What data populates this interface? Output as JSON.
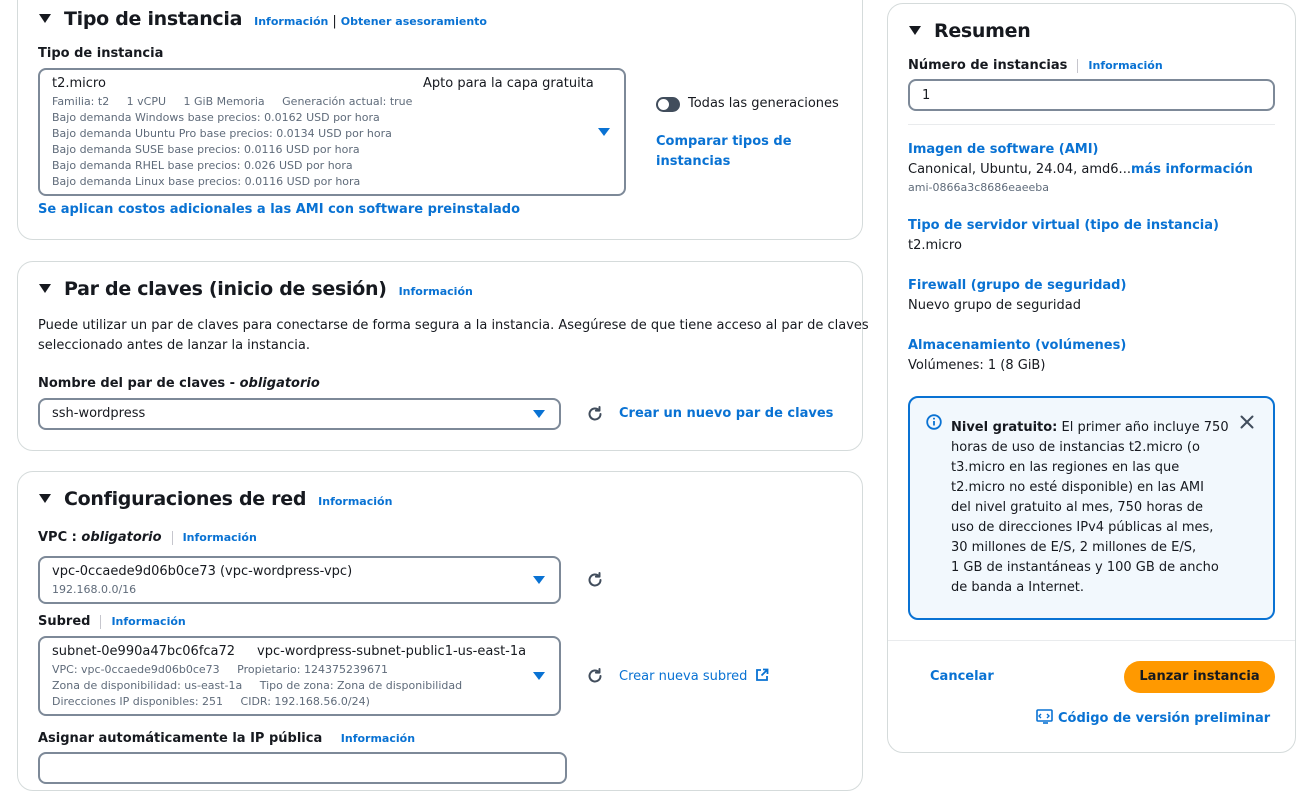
{
  "instance_type": {
    "title": "Tipo de instancia",
    "info": "Información",
    "advice": "Obtener asesoramiento",
    "field_label": "Tipo de instancia",
    "selected": "t2.micro",
    "free_tier": "Apto para la capa gratuita",
    "specs": "Familia: t2     1 vCPU     1 GiB Memoria     Generación actual: true",
    "pricing": [
      "Bajo demanda Windows base precios: 0.0162 USD por hora",
      "Bajo demanda Ubuntu Pro base precios: 0.0134 USD por hora",
      "Bajo demanda SUSE base precios: 0.0116 USD por hora",
      "Bajo demanda RHEL base precios: 0.026 USD por hora",
      "Bajo demanda Linux base precios: 0.0116 USD por hora"
    ],
    "all_generations": "Todas las generaciones",
    "compare_line1": "Comparar tipos de",
    "compare_line2": "instancias",
    "extra_costs": "Se aplican costos adicionales a las AMI con software preinstalado"
  },
  "key_pair": {
    "title": "Par de claves (inicio de sesión)",
    "info": "Información",
    "desc_line1": "Puede utilizar un par de claves para conectarse de forma segura a la instancia. Asegúrese de que tiene acceso al par de claves",
    "desc_line2": "seleccionado antes de lanzar la instancia.",
    "label": "Nombre del par de claves - ",
    "required": "obligatorio",
    "selected": "ssh-wordpress",
    "create": "Crear un nuevo par de claves"
  },
  "network": {
    "title": "Configuraciones de red",
    "info": "Información",
    "vpc_label": "VPC : ",
    "vpc_required": "obligatorio",
    "vpc_info": "Información",
    "vpc_value": "vpc-0ccaede9d06b0ce73 (vpc-wordpress-vpc)",
    "vpc_cidr": "192.168.0.0/16",
    "subnet_label": "Subred",
    "subnet_info": "Información",
    "subnet_id": "subnet-0e990a47bc06fca72",
    "subnet_name": "vpc-wordpress-subnet-public1-us-east-1a",
    "subnet_vpc": "VPC: vpc-0ccaede9d06b0ce73     Propietario: 124375239671",
    "subnet_zone": "Zona de disponibilidad: us-east-1a     Tipo de zona: Zona de disponibilidad",
    "subnet_ips": "Direcciones IP disponibles: 251     CIDR: 192.168.56.0/24)",
    "create_subnet": "Crear nueva subred",
    "public_ip_label": "Asignar automáticamente la IP pública",
    "public_ip_info": "Información"
  },
  "summary": {
    "title": "Resumen",
    "count_label": "Número de instancias",
    "count_info": "Información",
    "count_value": "1",
    "ami_label": "Imagen de software (AMI)",
    "ami_value": "Canonical, Ubuntu, 24.04, amd6...",
    "ami_more": "más información",
    "ami_id": "ami-0866a3c8686eaeeba",
    "server_label": "Tipo de servidor virtual (tipo de instancia)",
    "server_value": "t2.micro",
    "firewall_label": "Firewall (grupo de seguridad)",
    "firewall_value": "Nuevo grupo de seguridad",
    "storage_label": "Almacenamiento (volúmenes)",
    "storage_value": "Volúmenes: 1 (8 GiB)",
    "alert_bold": "Nivel gratuito:",
    "alert_lines": [
      " El primer año incluye 750",
      "horas de uso de instancias t2.micro (o",
      "t3.micro en las regiones en las que",
      "t2.micro no esté disponible) en las AMI",
      "del nivel gratuito al mes, 750 horas de",
      "uso de direcciones IPv4 públicas al mes,",
      "30 millones de E/S, 2 millones de E/S,",
      "1 GB de instantáneas y 100 GB de ancho",
      "de banda a Internet."
    ],
    "cancel": "Cancelar",
    "launch": "Lanzar instancia",
    "preview_code": "Código de versión preliminar"
  },
  "colors": {
    "accent": "#0972d3",
    "launch": "#ff9900",
    "border": "#7d8998"
  },
  "icons": [
    "caret-down-icon",
    "refresh-icon",
    "external-link-icon",
    "info-circle-icon",
    "close-icon",
    "code-preview-icon"
  ]
}
